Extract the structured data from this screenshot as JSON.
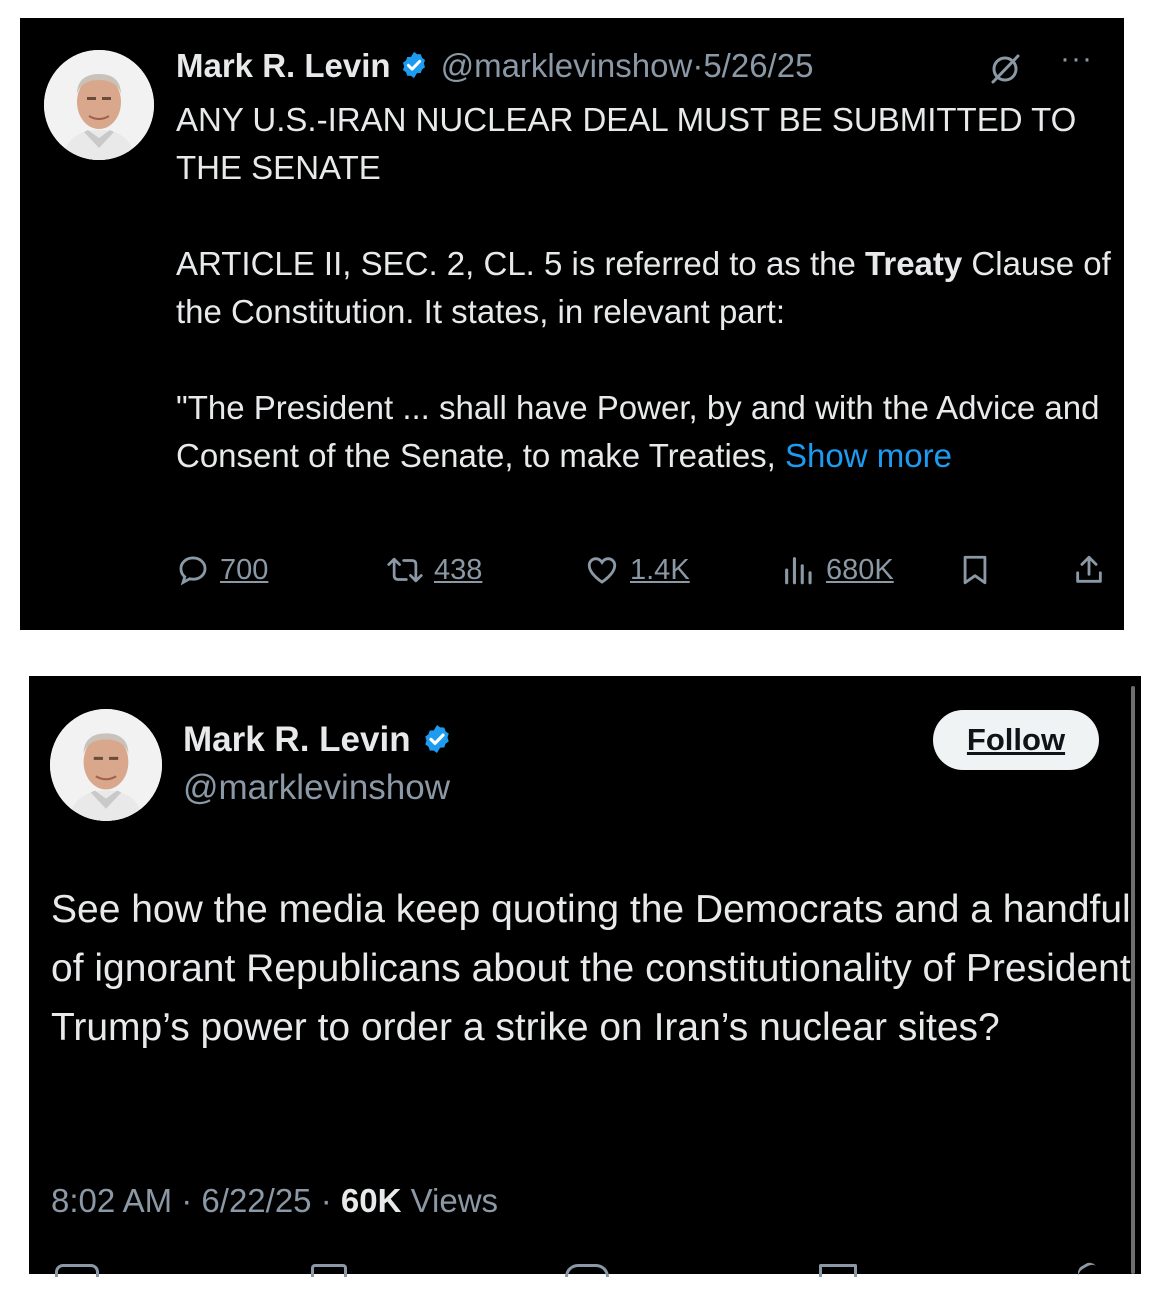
{
  "tweet1": {
    "name": "Mark R. Levin",
    "handle": "@marklevinshow",
    "date": "5/26/25",
    "body": {
      "line1": "ANY U.S.-IRAN NUCLEAR DEAL MUST BE SUBMITTED TO THE SENATE",
      "para2_pre": "ARTICLE II, SEC. 2, CL. 5 is referred to as the ",
      "para2_bold": "Treaty",
      "para2_post": " Clause of the Constitution.  It states, in relevant part:",
      "para3": "\"The President ... shall have Power, by and with the Advice and Consent of the Senate, to make Treaties, ",
      "show_more": "Show more"
    },
    "actions": {
      "replies": "700",
      "reposts": "438",
      "likes": "1.4K",
      "views": "680K"
    },
    "icons": [
      "verified-badge-icon",
      "grok-icon",
      "more-icon",
      "reply-icon",
      "repost-icon",
      "like-icon",
      "views-icon",
      "bookmark-icon",
      "share-icon"
    ]
  },
  "tweet2": {
    "name": "Mark R. Levin",
    "handle": "@marklevinshow",
    "follow_label": "Follow",
    "body": "See how the media keep quoting the Democrats and a handful of ignorant Republicans about the constitutionality of President Trump’s power to order a strike on Iran’s nuclear sites?",
    "time": "8:02 AM",
    "date": "6/22/25",
    "views_count": "60K",
    "views_label": "Views"
  },
  "colors": {
    "background": "#000000",
    "text": "#e7e9ea",
    "secondary": "#8b98a5",
    "link": "#1d9bf0",
    "verified": "#1d9bf0"
  }
}
